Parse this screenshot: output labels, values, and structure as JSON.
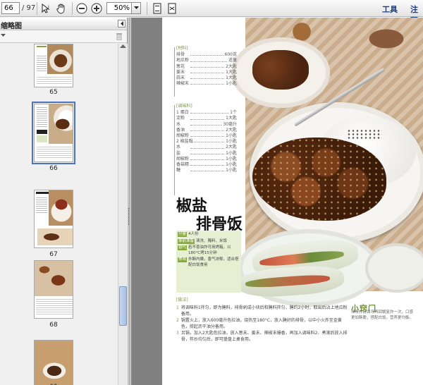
{
  "toolbar": {
    "page_current": "66",
    "page_total": "/ 97",
    "zoom": "50%",
    "menu_tools": "工具",
    "menu_comment": "注释"
  },
  "panel": {
    "title": "缩略图",
    "thumbnails": [
      {
        "label": "65"
      },
      {
        "label": "66",
        "selected": true
      },
      {
        "label": "67"
      },
      {
        "label": "68"
      },
      {
        "label": "69"
      }
    ]
  },
  "recipe": {
    "ingredients_label": "[材料]",
    "ingredients": [
      {
        "name": "排骨",
        "qty": "600克"
      },
      {
        "name": "地瓜粉",
        "qty": "适量"
      },
      {
        "name": "葱花",
        "qty": "2大匙"
      },
      {
        "name": "姜末",
        "qty": "1大匙"
      },
      {
        "name": "蒜末",
        "qty": "1大匙"
      },
      {
        "name": "辣椒末",
        "qty": "1小匙"
      }
    ],
    "seasoning_label": "[调味料]",
    "seasoning": [
      {
        "name": "1 蛋白",
        "qty": "1个"
      },
      {
        "name": "淀粉",
        "qty": "1大匙"
      },
      {
        "name": "水",
        "qty": "30毫升"
      },
      {
        "name": "香油",
        "qty": "2大匙"
      },
      {
        "name": "胡椒粉",
        "qty": "1小匙"
      },
      {
        "name": "2 椒盐粉",
        "qty": "1小匙"
      },
      {
        "name": "水",
        "qty": "2大匙"
      },
      {
        "name": "盐",
        "qty": "1小匙"
      },
      {
        "name": "胡椒粉",
        "qty": "1小匙"
      },
      {
        "name": "香菇精",
        "qty": "1小匙"
      },
      {
        "name": "糖",
        "qty": "1小匙"
      }
    ],
    "title_line1": "椒盐",
    "title_line2": "排骨饭",
    "info": [
      {
        "tag": "分量",
        "text": "4人份"
      },
      {
        "tag": "事前准备",
        "text": "清洗、腌料、米饭"
      },
      {
        "tag": "替代",
        "text": "若不喜油炸可用烤箱，以180°C烤15分钟"
      },
      {
        "tag": "美味",
        "text": "外酥内嫩，香气浓郁，适合搭配白饭食用"
      }
    ],
    "steps_label": "[做法]",
    "steps": [
      {
        "n": "1",
        "text": "将调味料1拌匀，即为腌料，排骨剁成小块后和腌料拌匀，腌约2小时，取出后沾上地瓜粉备用。"
      },
      {
        "n": "2",
        "text": "锅置火上，放入600毫升色拉油，烧热至180°C，放入腌好的排骨，以中小火炸至金黄色，捞起沥干油分备用。"
      },
      {
        "n": "3",
        "text": "另锅，加入2大匙色拉油，放入葱末、姜末、辣椒末爆香，再加入调味料2、煮滚后放入排骨，拌炒均匀后，即可盛盘上桌食用。"
      }
    ],
    "tip_badge": "小窍门",
    "tip_text": "排骨炸好后可再回锅复炸一次，口感更加酥脆，搭配白饭，营养更均衡。"
  }
}
